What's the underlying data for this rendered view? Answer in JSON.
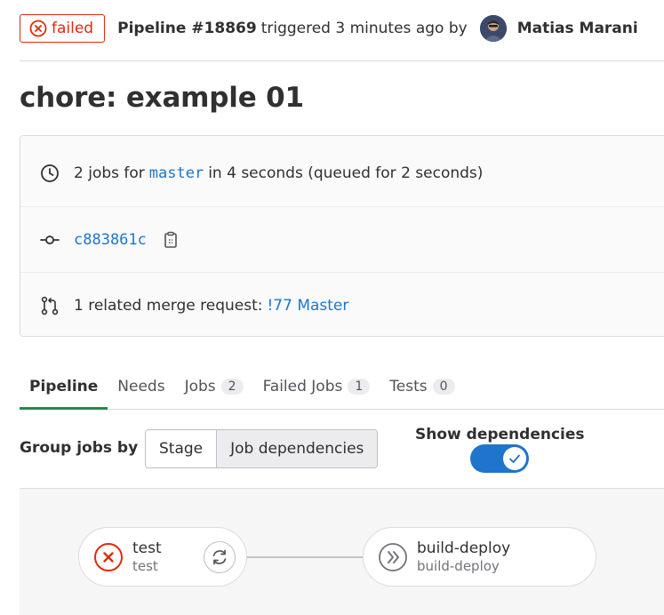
{
  "header": {
    "status": "failed",
    "pipeline_id": "Pipeline #18869",
    "triggered_text": "triggered 3 minutes ago by",
    "author": "Matias Marani"
  },
  "title": "chore: example 01",
  "info": {
    "jobs_count_text": "2 jobs for",
    "branch": "master",
    "duration_text": "in 4 seconds (queued for 2 seconds)",
    "commit_sha": "c883861c",
    "mr_text": "1 related merge request:",
    "mr_link": "!77 Master"
  },
  "tabs": [
    {
      "label": "Pipeline",
      "count": null,
      "active": true
    },
    {
      "label": "Needs",
      "count": null
    },
    {
      "label": "Jobs",
      "count": "2"
    },
    {
      "label": "Failed Jobs",
      "count": "1"
    },
    {
      "label": "Tests",
      "count": "0"
    }
  ],
  "controls": {
    "group_label": "Group jobs by",
    "stage_button": "Stage",
    "job_dependencies_button": "Job dependencies",
    "show_dependencies_label": "Show dependencies",
    "show_dependencies_on": true
  },
  "graph": {
    "jobs": [
      {
        "name": "test",
        "stage": "test",
        "status": "failed",
        "action": "retry-icon"
      },
      {
        "name": "build-deploy",
        "stage": "build-deploy",
        "status": "skipped"
      }
    ]
  },
  "colors": {
    "failed": "#dd2b0e",
    "link": "#1f75cb",
    "active_tab": "#1f8b4c",
    "toggle_on": "#1f75cb"
  }
}
